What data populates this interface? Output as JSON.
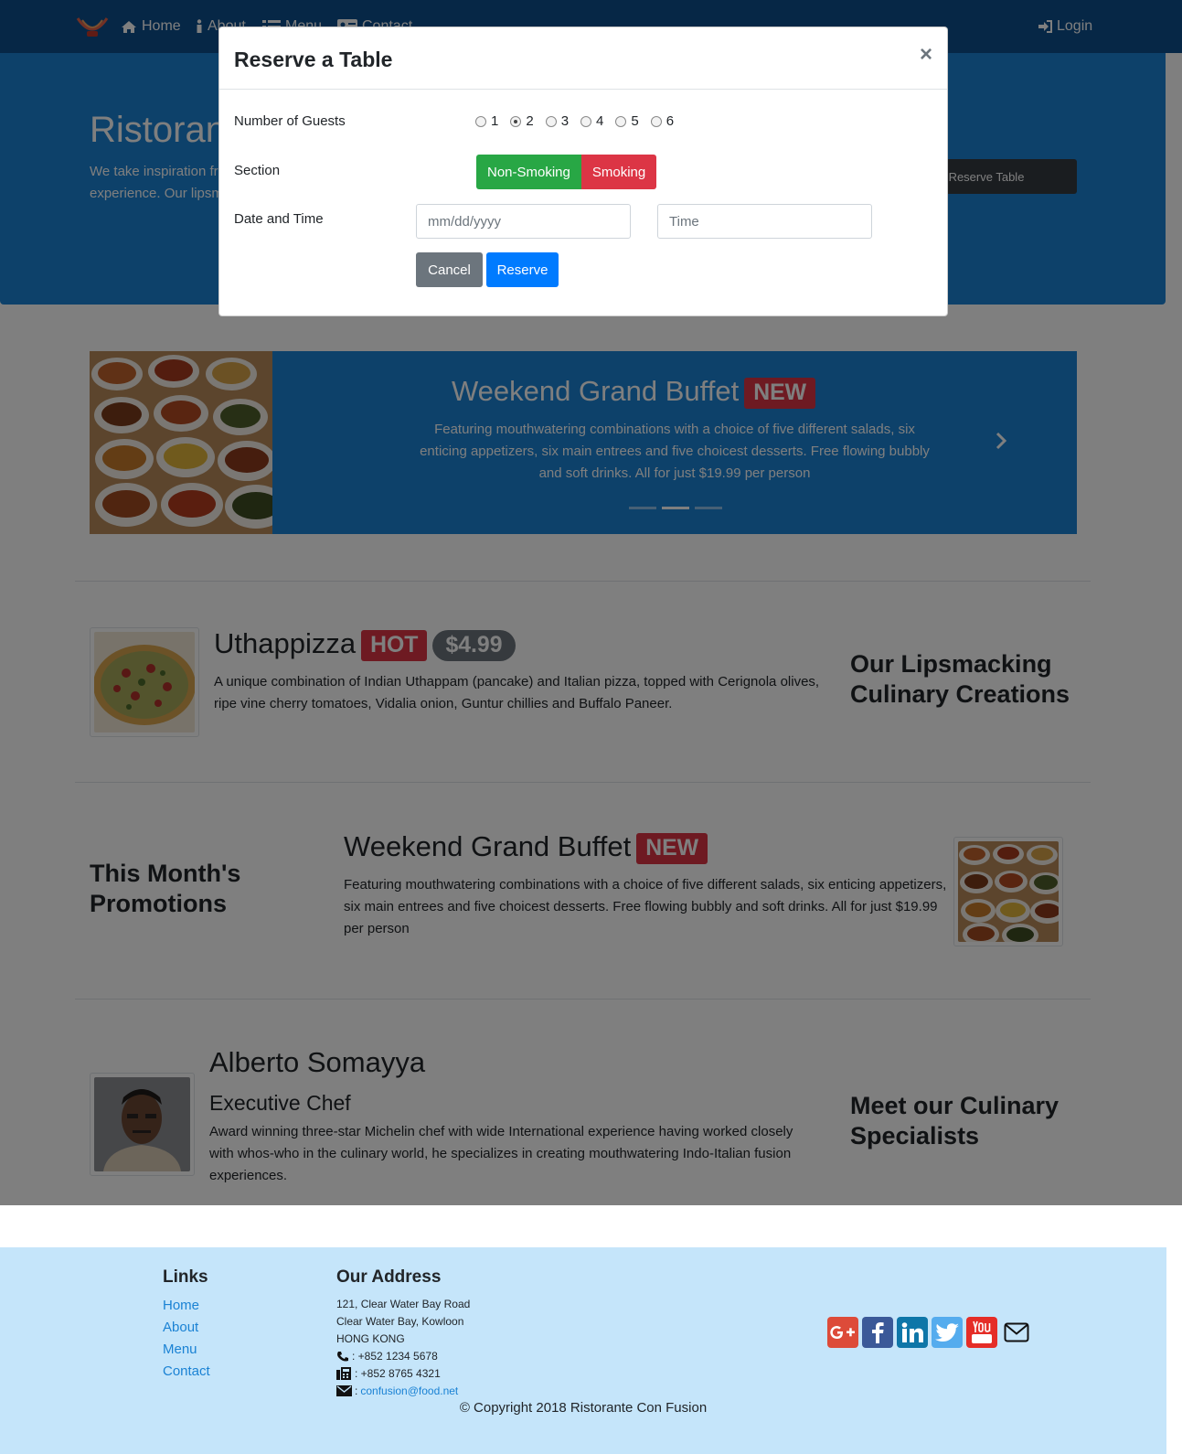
{
  "nav": {
    "home": "Home",
    "about": "About",
    "menu": "Menu",
    "contact": "Contact",
    "login": "Login"
  },
  "jumbotron": {
    "title": "Ristorante Con Fusion",
    "text": "We take inspiration from the World's best cuisines, and create a unique fusion experience. Our lipsmacking creations will tickle your culinary senses!",
    "reserve_button": "Reserve Table"
  },
  "carousel": {
    "title": "Weekend Grand Buffet",
    "badge": "NEW",
    "description": "Featuring mouthwatering combinations with a choice of five different salads, six enticing appetizers, six main entrees and five choicest desserts. Free flowing bubbly and soft drinks. All for just $19.99 per person",
    "active_slide": 2,
    "slide_count": 3
  },
  "dish": {
    "name": "Uthappizza",
    "badge": "HOT",
    "price": "$4.99",
    "description": "A unique combination of Indian Uthappam (pancake) and Italian pizza, topped with Cerignola olives, ripe vine cherry tomatoes, Vidalia onion, Guntur chillies and Buffalo Paneer.",
    "side_heading": "Our Lipsmacking Culinary Creations"
  },
  "promotion": {
    "side_heading": "This Month's Promotions",
    "name": "Weekend Grand Buffet",
    "badge": "NEW",
    "description": "Featuring mouthwatering combinations with a choice of five different salads, six enticing appetizers, six main entrees and five choicest desserts. Free flowing bubbly and soft drinks. All for just $19.99 per person"
  },
  "leader": {
    "name": "Alberto Somayya",
    "designation": "Executive Chef",
    "description": "Award winning three-star Michelin chef with wide International experience having worked closely with whos-who in the culinary world, he specializes in creating mouthwatering Indo-Italian fusion experiences.",
    "side_heading": "Meet our Culinary Specialists"
  },
  "footer": {
    "links_heading": "Links",
    "links": [
      "Home",
      "About",
      "Menu",
      "Contact"
    ],
    "address_heading": "Our Address",
    "address_line1": "121, Clear Water Bay Road",
    "address_line2": "Clear Water Bay, Kowloon",
    "address_line3": "HONG KONG",
    "phone": ": +852 1234 5678",
    "fax": ": +852 8765 4321",
    "email_prefix": ":",
    "email": "confusion@food.net",
    "copyright": "© Copyright 2018 Ristorante Con Fusion",
    "social_icons": [
      "google-plus-icon",
      "facebook-icon",
      "linkedin-icon",
      "twitter-icon",
      "youtube-icon",
      "envelope-icon"
    ]
  },
  "modal": {
    "title": "Reserve a Table",
    "close": "×",
    "guests_label": "Number of Guests",
    "guest_options": [
      "1",
      "2",
      "3",
      "4",
      "5",
      "6"
    ],
    "guests_selected": "2",
    "section_label": "Section",
    "section_non_smoking": "Non-Smoking",
    "section_smoking": "Smoking",
    "datetime_label": "Date and Time",
    "date_placeholder": "mm/dd/yyyy",
    "time_placeholder": "Time",
    "cancel_button": "Cancel",
    "reserve_button": "Reserve"
  },
  "colors": {
    "navbar": "#0d4f8c",
    "jumbotron": "#1a82d4",
    "footer": "#c5e5fa",
    "danger": "#dc3545",
    "success": "#28a745",
    "primary": "#007bff",
    "secondary": "#6c757d"
  }
}
